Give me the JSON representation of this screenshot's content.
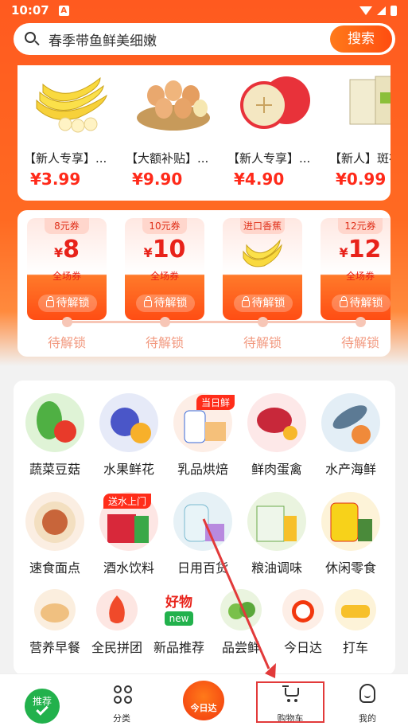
{
  "status_bar": {
    "time": "10:07",
    "app_badge": "A"
  },
  "search": {
    "placeholder": "春季带鱼鲜美细嫩",
    "button_label": "搜索"
  },
  "products": [
    {
      "name": "【新人专享】...",
      "price": "¥3.99",
      "image": "banana"
    },
    {
      "name": "【大额补贴】...",
      "price": "¥9.90",
      "image": "eggs"
    },
    {
      "name": "【新人专享】...",
      "price": "¥4.90",
      "image": "apple"
    },
    {
      "name": "【新人】斑布",
      "price": "¥0.99",
      "image": "tissue"
    }
  ],
  "coupons": [
    {
      "tag": "8元券",
      "currency": "¥",
      "amount": "8",
      "scope": "全场券",
      "button": "待解锁"
    },
    {
      "tag": "10元券",
      "currency": "¥",
      "amount": "10",
      "scope": "全场券",
      "button": "待解锁"
    },
    {
      "tag": "进口香蕉",
      "currency": "",
      "amount": "",
      "scope": "",
      "button": "待解锁"
    },
    {
      "tag": "12元券",
      "currency": "¥",
      "amount": "12",
      "scope": "全场券",
      "button": "待解锁"
    }
  ],
  "progress_labels": [
    "待解锁",
    "待解锁",
    "待解锁",
    "待解锁"
  ],
  "categories": [
    {
      "label": "蔬菜豆菇",
      "icon": "vegetable-icon"
    },
    {
      "label": "水果鲜花",
      "icon": "fruit-icon"
    },
    {
      "label": "乳品烘焙",
      "icon": "dairy-icon",
      "badge": "当日鲜"
    },
    {
      "label": "鲜肉蛋禽",
      "icon": "meat-icon"
    },
    {
      "label": "水产海鲜",
      "icon": "seafood-icon"
    },
    {
      "label": "速食面点",
      "icon": "dumpling-icon"
    },
    {
      "label": "酒水饮料",
      "icon": "drinks-icon",
      "badge": "送水上门"
    },
    {
      "label": "日用百货",
      "icon": "daily-goods-icon"
    },
    {
      "label": "粮油调味",
      "icon": "rice-oil-icon"
    },
    {
      "label": "休闲零食",
      "icon": "snack-icon"
    }
  ],
  "quick_links": [
    {
      "label": "营养早餐",
      "icon": "breakfast-icon"
    },
    {
      "label": "全民拼团",
      "icon": "group-buy-icon"
    },
    {
      "label": "新品推荐",
      "icon": "new-product-icon",
      "badge_top": "好物",
      "badge_bottom": "new"
    },
    {
      "label": "品尝鲜",
      "icon": "taste-icon"
    },
    {
      "label": "今日达",
      "icon": "today-delivery-icon"
    },
    {
      "label": "打车",
      "icon": "taxi-icon"
    }
  ],
  "bottom_nav": {
    "recommend": "推荐",
    "category": "分类",
    "today": "今日达",
    "cart": "购物车",
    "me": "我的"
  },
  "colors": {
    "accent": "#ff5a1f",
    "price": "#ff2a1a",
    "green": "#22b14c",
    "annotation": "#e23a3a"
  }
}
